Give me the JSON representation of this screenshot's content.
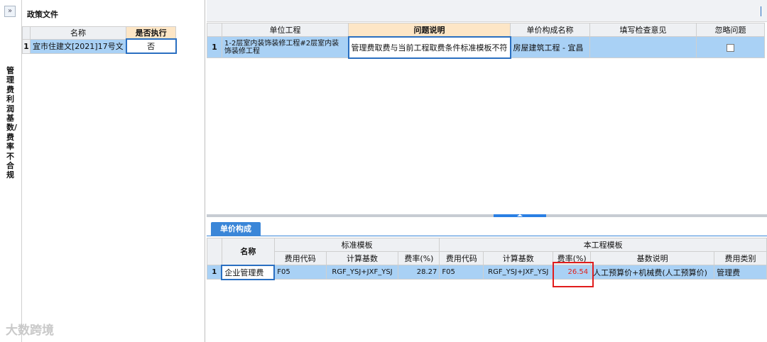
{
  "side": {
    "collapse_symbol": "»",
    "vertical_title": "管理费利润基数/费率不合规"
  },
  "policy": {
    "title": "政策文件",
    "columns": [
      "名称",
      "是否执行"
    ],
    "rows": [
      {
        "num": "1",
        "name": "宜市住建文[2021]17号文",
        "execute": "否"
      }
    ]
  },
  "issues": {
    "columns": [
      "单位工程",
      "问题说明",
      "单价构成名称",
      "填写检查意见",
      "忽略问题"
    ],
    "rows": [
      {
        "num": "1",
        "unit": "1-2层室内装饰装修工程#2层室内装饰装修工程",
        "desc": "管理费取费与当前工程取费条件标准模板不符",
        "composition": "房屋建筑工程 - 宜昌",
        "opinion": "",
        "ignore": false
      }
    ]
  },
  "lower_tab": {
    "label": "单价构成"
  },
  "composition": {
    "name_header": "名称",
    "group_standard": "标准模板",
    "group_project": "本工程模板",
    "sub_columns_standard": [
      "费用代码",
      "计算基数",
      "费率(%)"
    ],
    "sub_columns_project": [
      "费用代码",
      "计算基数",
      "费率(%)",
      "基数说明",
      "费用类别"
    ],
    "rows": [
      {
        "num": "1",
        "name": "企业管理费",
        "std_code": "F05",
        "std_base": "RGF_YSJ+JXF_YSJ",
        "std_rate": "28.27",
        "prj_code": "F05",
        "prj_base": "RGF_YSJ+JXF_YSJ",
        "prj_rate": "26.54",
        "base_desc": "人工预算价+机械费(人工预算价)",
        "fee_type": "管理费"
      }
    ]
  },
  "colors": {
    "accent": "#3a86d8",
    "header_highlight": "#fde6c6",
    "row_selected": "#a9d1f5",
    "warning": "#e0201b"
  },
  "watermark": "大数跨境"
}
